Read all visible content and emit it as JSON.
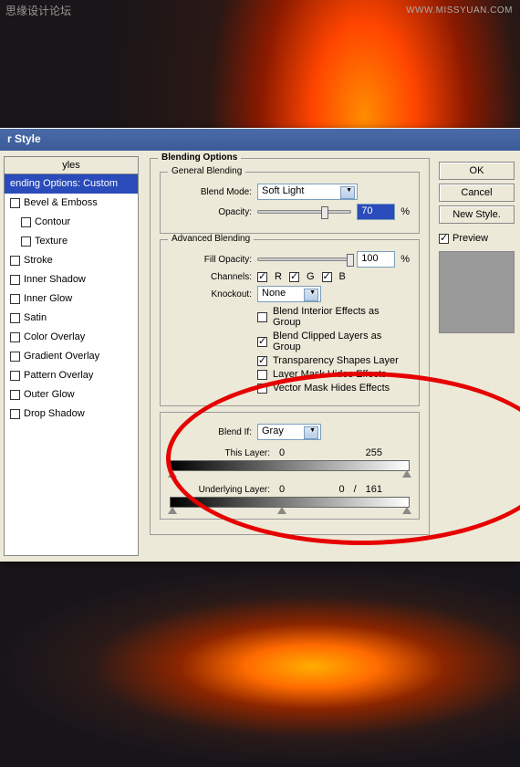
{
  "watermark": "思缘设计论坛",
  "watermark_url": "WWW.MISSYUAN.COM",
  "dialog": {
    "title": "r Style",
    "styles_header": "yles",
    "styles": [
      {
        "label": "ending Options: Custom",
        "checked": false,
        "selected": true,
        "hasCheckbox": false
      },
      {
        "label": "Bevel & Emboss",
        "checked": false,
        "hasCheckbox": true
      },
      {
        "label": "Contour",
        "checked": false,
        "indent": true,
        "hasCheckbox": true
      },
      {
        "label": "Texture",
        "checked": false,
        "indent": true,
        "hasCheckbox": true
      },
      {
        "label": "Stroke",
        "checked": false,
        "hasCheckbox": true
      },
      {
        "label": "Inner Shadow",
        "checked": false,
        "hasCheckbox": true
      },
      {
        "label": "Inner Glow",
        "checked": false,
        "hasCheckbox": true
      },
      {
        "label": "Satin",
        "checked": false,
        "hasCheckbox": true
      },
      {
        "label": "Color Overlay",
        "checked": false,
        "hasCheckbox": true
      },
      {
        "label": "Gradient Overlay",
        "checked": false,
        "hasCheckbox": true
      },
      {
        "label": "Pattern Overlay",
        "checked": false,
        "hasCheckbox": true
      },
      {
        "label": "Outer Glow",
        "checked": false,
        "hasCheckbox": true
      },
      {
        "label": "Drop Shadow",
        "checked": false,
        "hasCheckbox": true
      }
    ]
  },
  "blending_options": {
    "section_title": "Blending Options",
    "general": {
      "title": "General Blending",
      "blend_mode_label": "Blend Mode:",
      "blend_mode": "Soft Light",
      "opacity_label": "Opacity:",
      "opacity": "70",
      "opacity_suffix": "%"
    },
    "advanced": {
      "title": "Advanced Blending",
      "fill_opacity_label": "Fill Opacity:",
      "fill_opacity": "100",
      "fill_opacity_suffix": "%",
      "channels_label": "Channels:",
      "ch_r": "R",
      "ch_g": "G",
      "ch_b": "B",
      "knockout_label": "Knockout:",
      "knockout": "None",
      "opt1": "Blend Interior Effects as Group",
      "opt2": "Blend Clipped Layers as Group",
      "opt3": "Transparency Shapes Layer",
      "opt4": "Layer Mask Hides Effects",
      "opt5": "Vector Mask Hides Effects"
    },
    "blend_if": {
      "label": "Blend If:",
      "value": "Gray",
      "this_layer_label": "This Layer:",
      "this_low": "0",
      "this_high": "255",
      "under_label": "Underlying Layer:",
      "under_low": "0",
      "under_mid": "0",
      "under_sep": "/",
      "under_high": "161"
    }
  },
  "buttons": {
    "ok": "OK",
    "cancel": "Cancel",
    "new_style": "New Style.",
    "preview": "Preview"
  }
}
